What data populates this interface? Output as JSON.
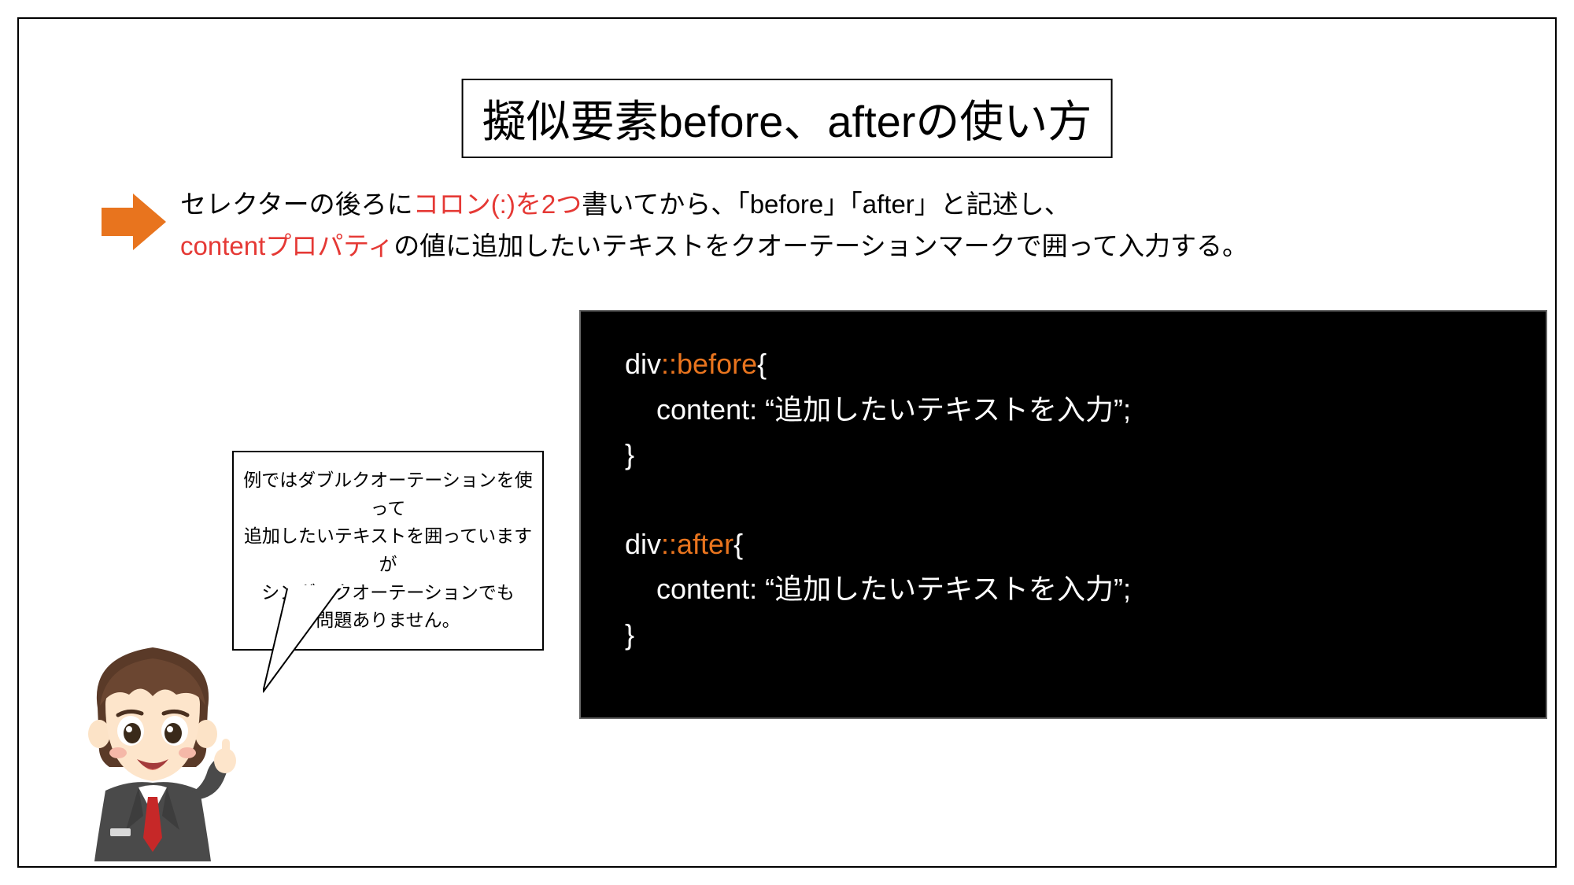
{
  "title": "擬似要素before、afterの使い方",
  "desc": {
    "part1": "セレクターの後ろに",
    "hl1": "コロン(:)を2つ",
    "part2": "書いてから、「before」「after」と記述し、",
    "hl2": "contentプロパティ",
    "part3": "の値に追加したいテキストをクオーテーションマークで囲って入力する。"
  },
  "speech": {
    "l1": "例ではダブルクオーテーションを使って",
    "l2": "追加したいテキストを囲っていますが",
    "l3": "シングルクオーテーションでも",
    "l4": "問題ありません。"
  },
  "code": {
    "b_sel": "div",
    "b_pseudo": "::before",
    "b_open": "{",
    "b_content": "    content: “追加したいテキストを入力”;",
    "b_close": "}",
    "a_sel": "div",
    "a_pseudo": "::after",
    "a_open": "{",
    "a_content": "    content: “追加したいテキストを入力”;",
    "a_close": "}"
  },
  "icons": {
    "arrow": "arrow-right-icon",
    "character": "businessman-character-icon"
  }
}
